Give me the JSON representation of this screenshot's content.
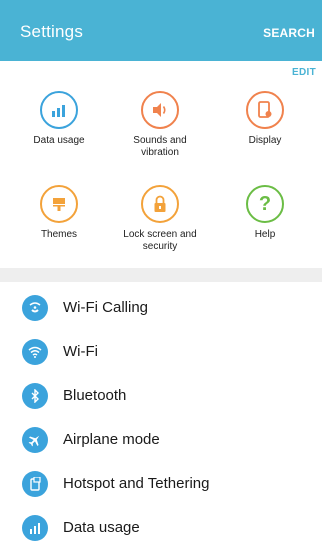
{
  "header": {
    "title": "Settings",
    "search_label": "SEARCH"
  },
  "quick_settings": {
    "edit_label": "EDIT",
    "items": [
      {
        "label": "Data usage",
        "icon": "data-usage-icon",
        "color": "#3ba3dc"
      },
      {
        "label": "Sounds and\nvibration",
        "icon": "speaker-icon",
        "color": "#f0824d"
      },
      {
        "label": "Display",
        "icon": "display-icon",
        "color": "#f0824d"
      },
      {
        "label": "Themes",
        "icon": "themes-icon",
        "color": "#f3a23a"
      },
      {
        "label": "Lock screen and\nsecurity",
        "icon": "lock-icon",
        "color": "#f3a23a"
      },
      {
        "label": "Help",
        "icon": "help-icon",
        "color": "#6bbd45"
      }
    ]
  },
  "settings_list": [
    {
      "label": "Wi-Fi Calling",
      "icon": "wifi-calling-icon"
    },
    {
      "label": "Wi-Fi",
      "icon": "wifi-icon"
    },
    {
      "label": "Bluetooth",
      "icon": "bluetooth-icon"
    },
    {
      "label": "Airplane mode",
      "icon": "airplane-icon"
    },
    {
      "label": "Hotspot and Tethering",
      "icon": "hotspot-icon"
    },
    {
      "label": "Data usage",
      "icon": "data-usage-icon"
    }
  ],
  "colors": {
    "appbar": "#4ab3d4",
    "list_icon": "#3ba3dc",
    "accent": "#4ab3d4"
  }
}
